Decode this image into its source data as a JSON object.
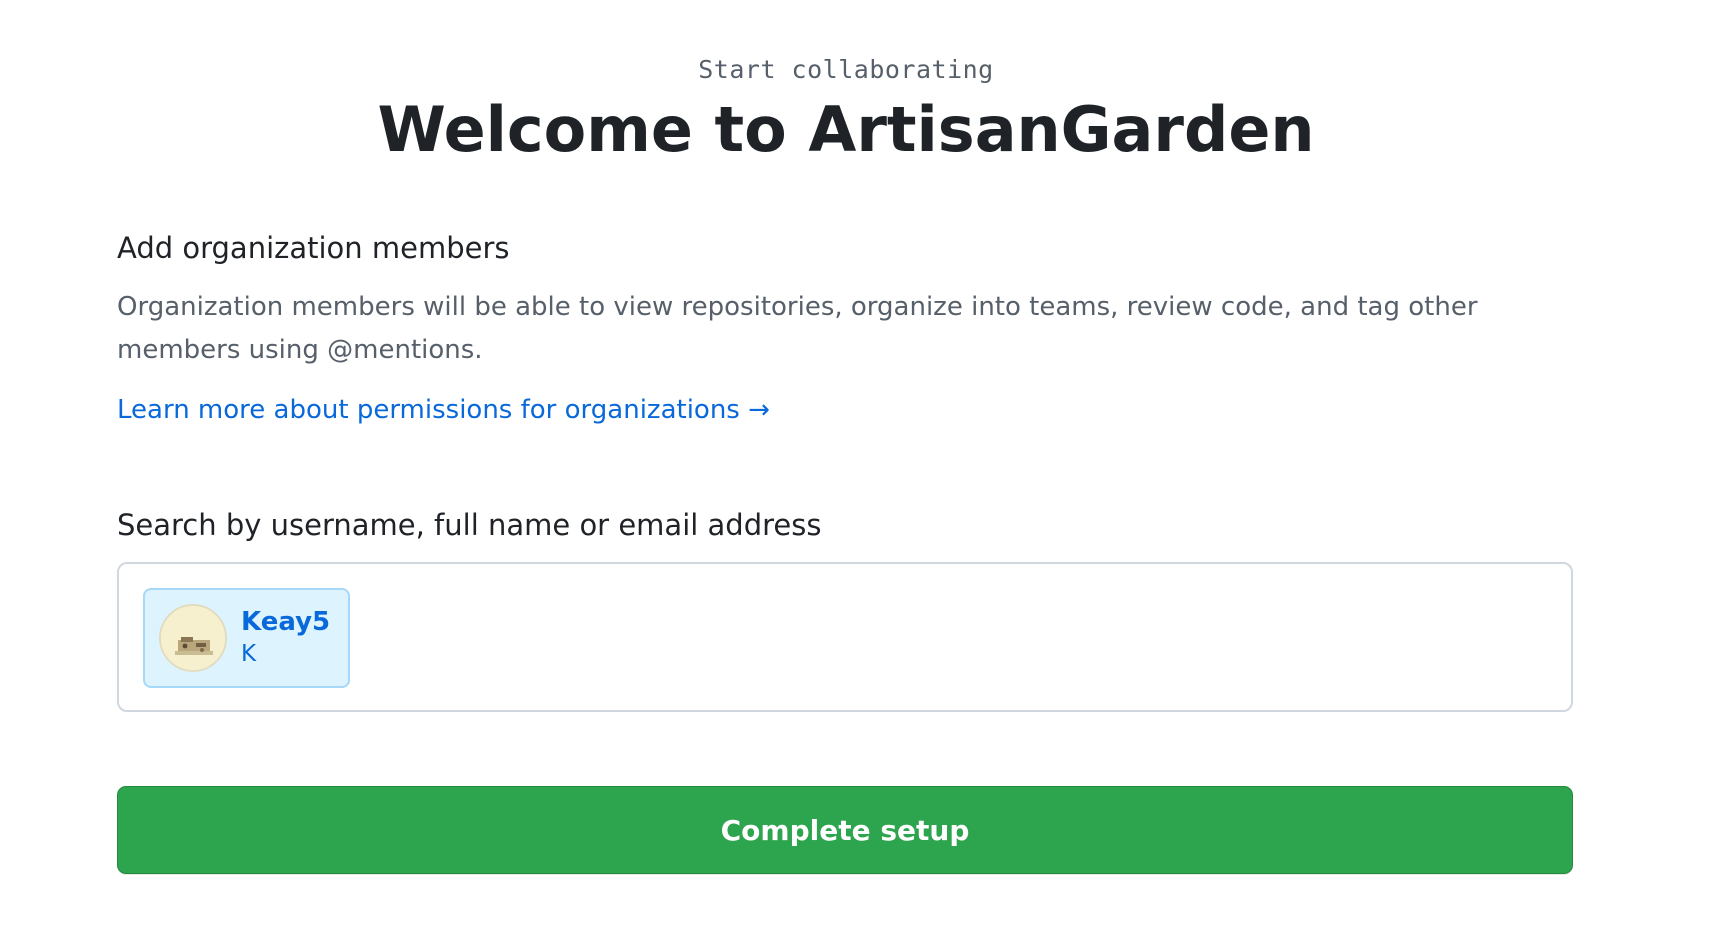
{
  "hero": {
    "eyebrow": "Start collaborating",
    "title": "Welcome to ArtisanGarden"
  },
  "members_section": {
    "heading": "Add organization members",
    "description": "Organization members will be able to view repositories, organize into teams, review code, and tag other members using @mentions.",
    "learn_more_link": "Learn more about permissions for organizations →"
  },
  "search": {
    "label": "Search by username, full name or email address",
    "selected_members": [
      {
        "username": "Keay5",
        "name": "K",
        "avatar_icon": "user-avatar"
      }
    ]
  },
  "actions": {
    "complete_label": "Complete setup"
  },
  "colors": {
    "primary_button": "#2da44e",
    "link": "#0969da",
    "chip_background": "#ddf4ff",
    "heading_text": "#1f2328",
    "muted_text": "#57606a"
  }
}
